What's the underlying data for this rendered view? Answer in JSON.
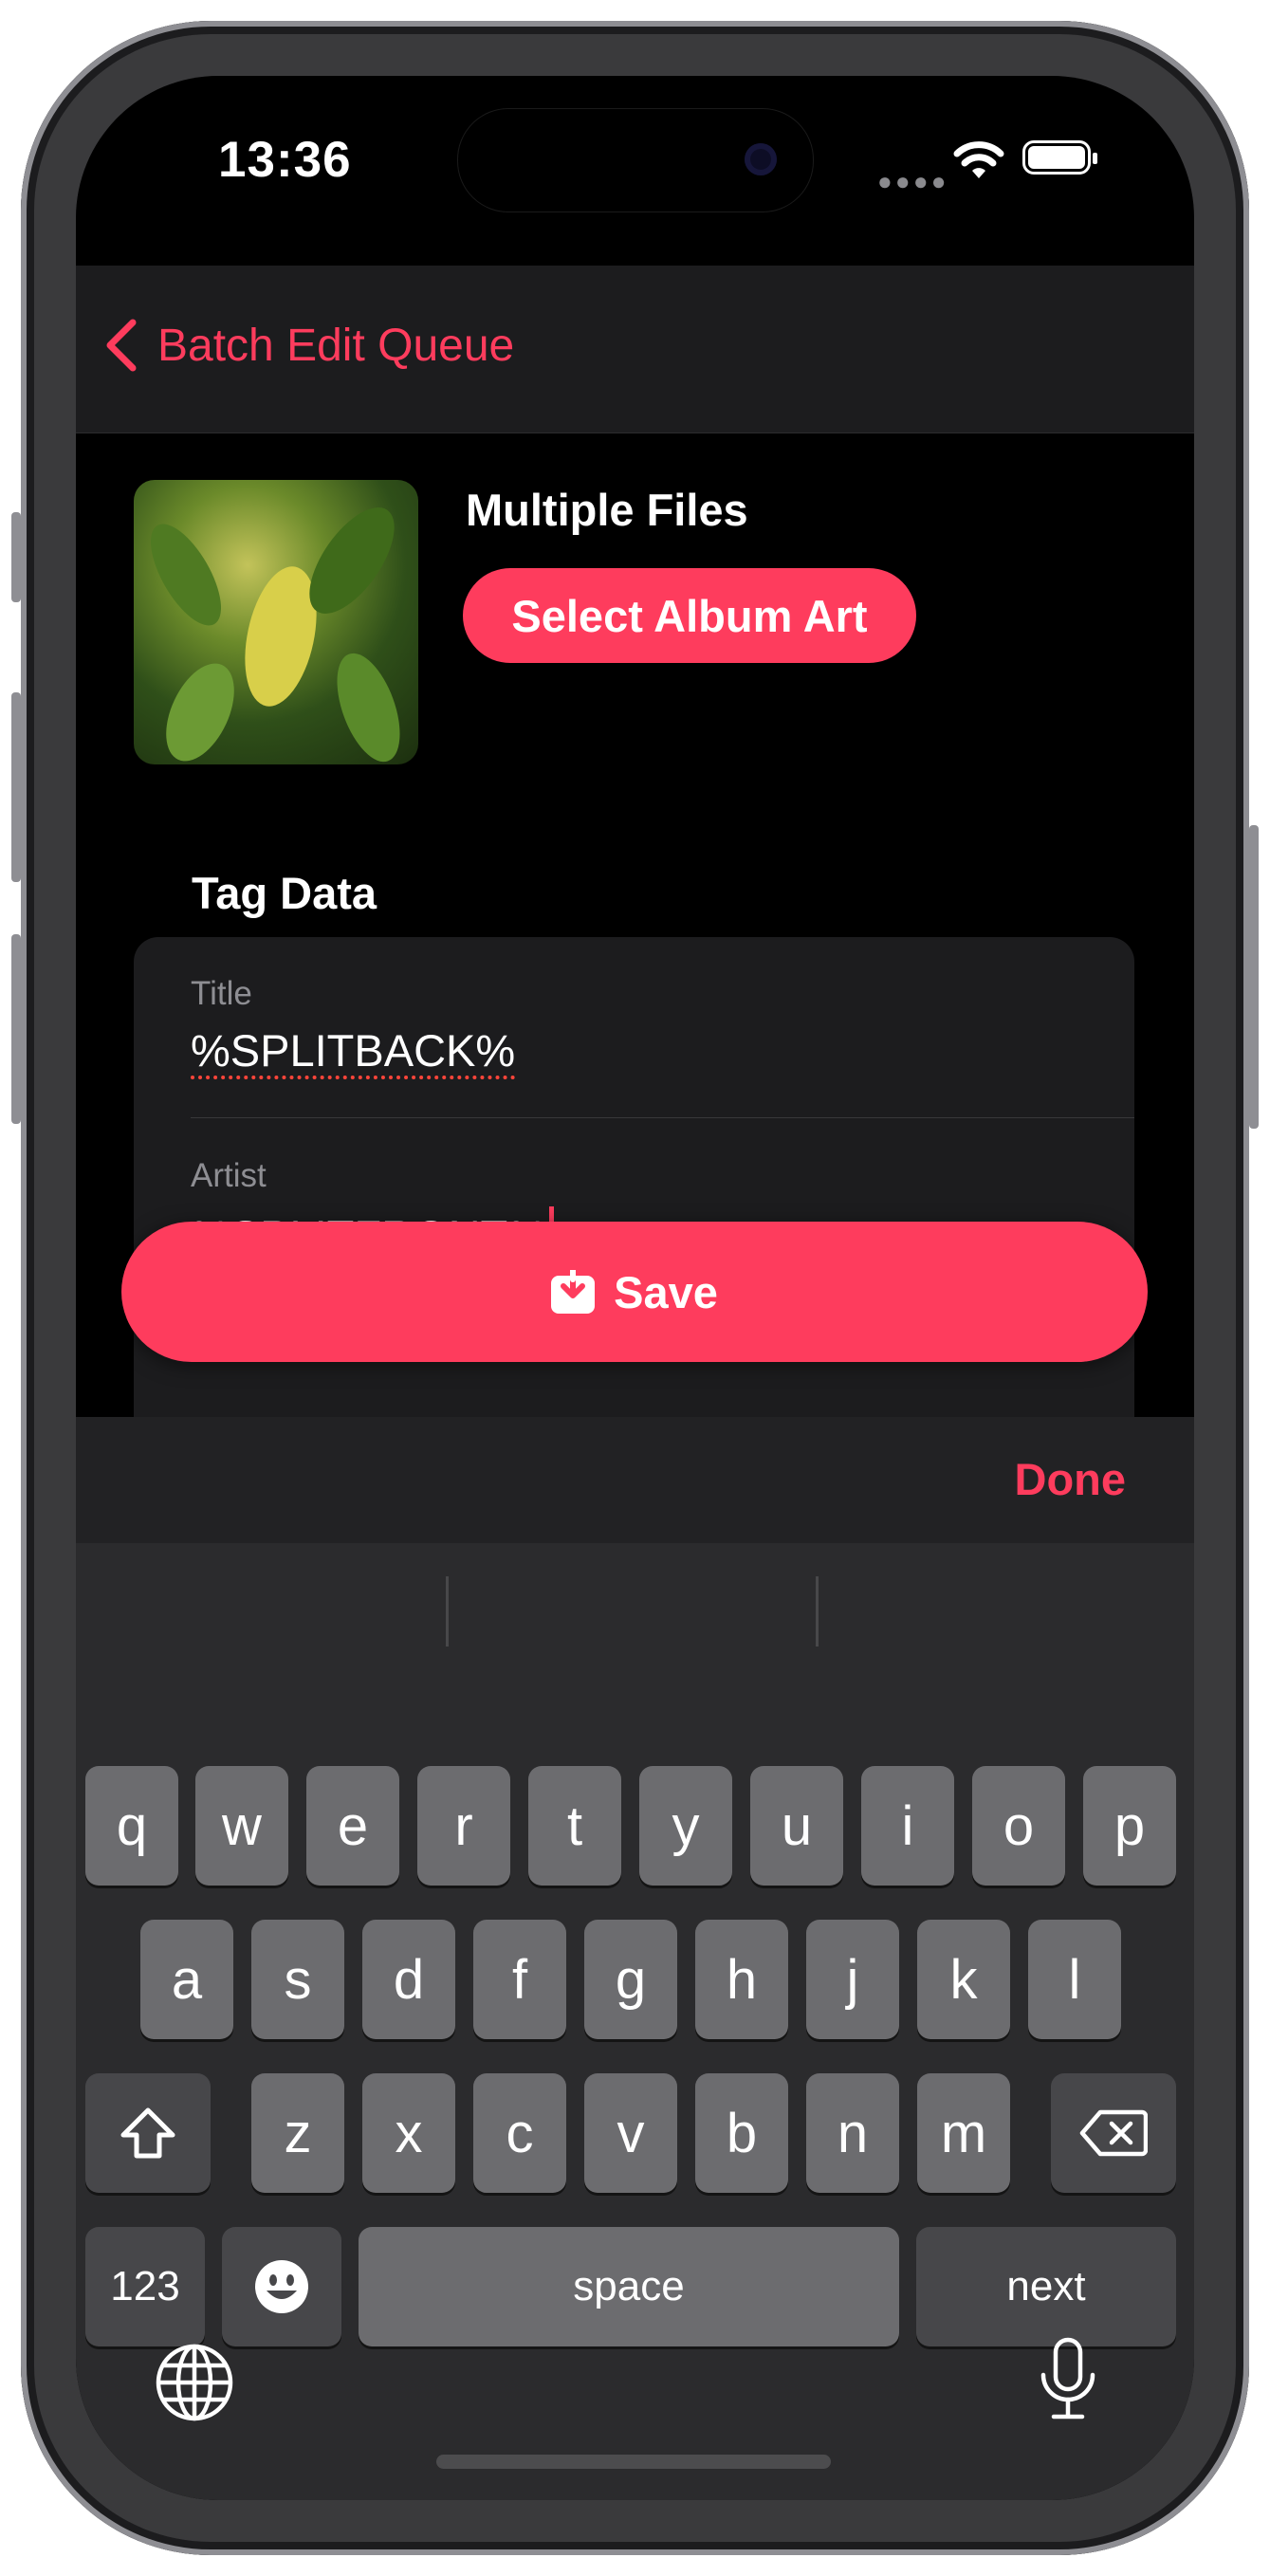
{
  "status_bar": {
    "time": "13:36"
  },
  "nav": {
    "back_label": "Batch Edit Queue"
  },
  "header": {
    "title": "Multiple Files",
    "select_art_label": "Select Album Art"
  },
  "section": {
    "title": "Tag Data"
  },
  "fields": [
    {
      "label": "Title",
      "value": "%SPLITBACK%"
    },
    {
      "label": "Artist",
      "value": "%SPLITFRONT%"
    }
  ],
  "save_button": {
    "label": "Save"
  },
  "keyboard": {
    "done_label": "Done",
    "row1": [
      "q",
      "w",
      "e",
      "r",
      "t",
      "y",
      "u",
      "i",
      "o",
      "p"
    ],
    "row2": [
      "a",
      "s",
      "d",
      "f",
      "g",
      "h",
      "j",
      "k",
      "l"
    ],
    "row3": [
      "z",
      "x",
      "c",
      "v",
      "b",
      "n",
      "m"
    ],
    "numbers_label": "123",
    "space_label": "space",
    "next_label": "next"
  },
  "colors": {
    "accent": "#fe3c5d",
    "background": "#000000",
    "card": "#1c1c1e"
  }
}
